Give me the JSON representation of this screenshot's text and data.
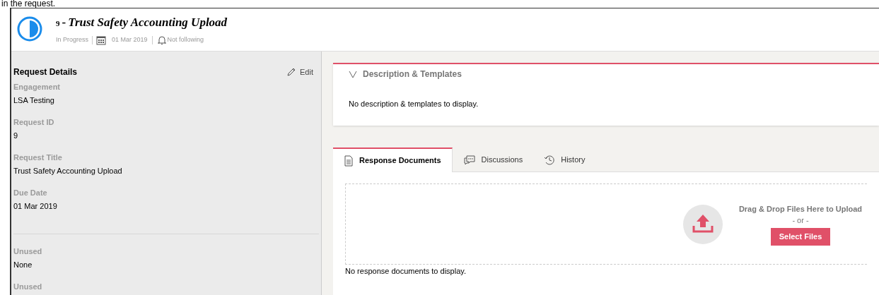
{
  "caption": "in the request.",
  "header": {
    "number": "9",
    "separator": "-",
    "title": "Trust Safety Accounting Upload",
    "status": "In Progress",
    "due_date": "01 Mar 2019",
    "following": "Not following"
  },
  "details": {
    "title": "Request Details",
    "edit": "Edit",
    "fields": [
      {
        "label": "Engagement",
        "value": "LSA Testing"
      },
      {
        "label": "Request ID",
        "value": "9"
      },
      {
        "label": "Request Title",
        "value": "Trust Safety Accounting Upload"
      },
      {
        "label": "Due Date",
        "value": "01 Mar 2019"
      }
    ],
    "extra_fields": [
      {
        "label": "Unused",
        "value": "None"
      },
      {
        "label": "Unused"
      }
    ]
  },
  "description": {
    "title": "Description & Templates",
    "expanded": true,
    "empty_text": "No description & templates to display."
  },
  "tabs": [
    {
      "label": "Response Documents",
      "kind": "document",
      "selected": true
    },
    {
      "label": "Discussions",
      "kind": "chat",
      "selected": false
    },
    {
      "label": "History",
      "kind": "history",
      "selected": false
    }
  ],
  "upload": {
    "prompt": "Drag & Drop Files Here to Upload",
    "or": "- or -",
    "button": "Select Files",
    "empty_text": "No response documents to display."
  }
}
